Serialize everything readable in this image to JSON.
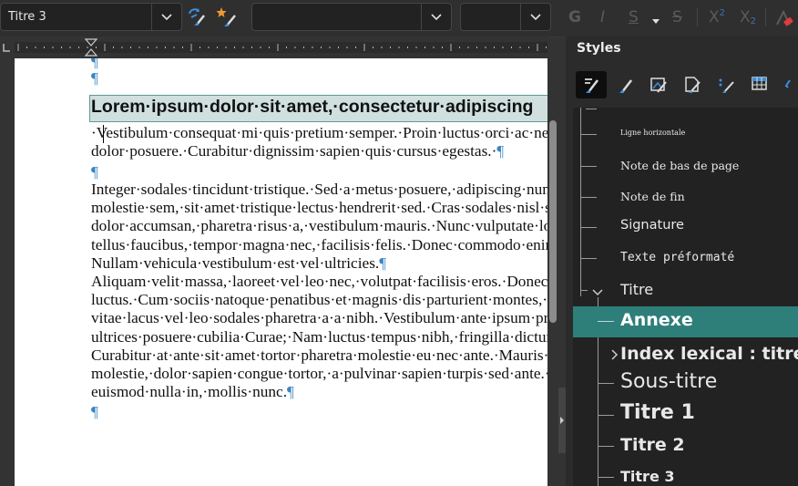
{
  "toolbar": {
    "paragraph_style": "Titre 3",
    "font_name": "",
    "font_size": "",
    "bold_glyph": "G",
    "italic_glyph": "I",
    "underline_glyph": "S",
    "strike_glyph": "S",
    "superscript_glyph": "X",
    "superscript_mark": "2",
    "subscript_glyph": "X",
    "subscript_mark": "2"
  },
  "document": {
    "pilcrow": "¶",
    "heading": "Lorem·ipsum·dolor·sit·amet,·consectetur·adipiscing",
    "para1": [
      "·Vestibulum·consequat·mi·quis·pretium·semper.·Proin·luctus·orci·ac·neq",
      "dolor·posuere.·Curabitur·dignissim·sapien·quis·cursus·egestas.·"
    ],
    "para2": [
      "Integer·sodales·tincidunt·tristique.·Sed·a·metus·posuere,·adipiscing·nun",
      "molestie·sem,·sit·amet·tristique·lectus·hendrerit·sed.·Cras·sodales·nisl·se",
      "dolor·accumsan,·pharetra·risus·a,·vestibulum·mauris.·Nunc·vulputate·lo",
      "tellus·faucibus,·tempor·magna·nec,·facilisis·felis.·Donec·commodo·enin",
      "Nullam·vehicula·vestibulum·est·vel·ultricies."
    ],
    "para3": [
      "Aliquam·velit·massa,·laoreet·vel·leo·nec,·volutpat·facilisis·eros.·Donec·",
      "luctus.·Cum·sociis·natoque·penatibus·et·magnis·dis·parturient·montes,·n",
      "vitae·lacus·vel·leo·sodales·pharetra·a·a·nibh.·Vestibulum·ante·ipsum·prin",
      "ultrices·posuere·cubilia·Curae;·Nam·luctus·tempus·nibh,·fringilla·dictur",
      "Curabitur·at·ante·sit·amet·tortor·pharetra·molestie·eu·nec·ante.·Mauris·ti",
      "molestie,·dolor·sapien·congue·tortor,·a·pulvinar·sapien·turpis·sed·ante.·N",
      "euismod·nulla·in,·mollis·nunc."
    ]
  },
  "styles_panel": {
    "title": "Styles",
    "tool_icons": [
      "paragraph-styles-icon",
      "character-styles-icon",
      "frame-styles-icon",
      "page-styles-icon",
      "list-styles-icon",
      "table-styles-icon"
    ],
    "tree": {
      "ligne_horizontale": "Ligne horizontale",
      "note_bas_page": "Note de bas de page",
      "note_fin": "Note de fin",
      "signature": "Signature",
      "texte_preformate": "Texte préformaté",
      "titre": "Titre",
      "annexe": "Annexe",
      "index_lexical": "Index lexical : titre",
      "sous_titre": "Sous-titre",
      "titre1": "Titre 1",
      "titre2": "Titre 2",
      "titre3": "Titre 3"
    }
  },
  "colors": {
    "selected_row": "#2e7f79",
    "heading_highlight": "#cfe0de",
    "formatting_marks": "#3a86c4"
  }
}
